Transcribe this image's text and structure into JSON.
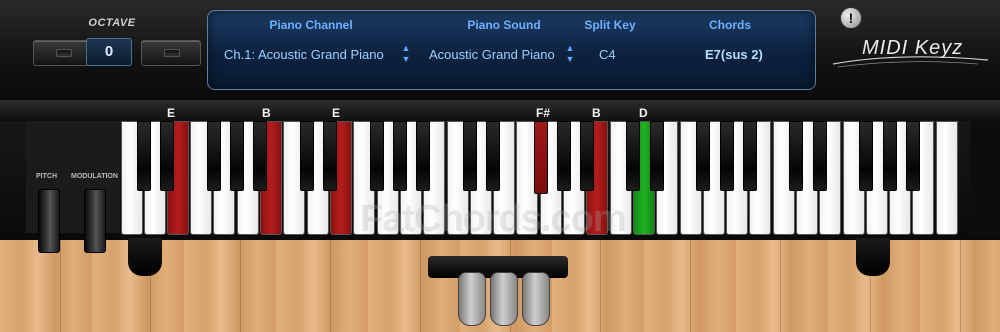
{
  "octave": {
    "label": "OCTAVE",
    "value": "0"
  },
  "lcd": {
    "channel": {
      "header": "Piano Channel",
      "value": "Ch.1: Acoustic Grand Piano"
    },
    "sound": {
      "header": "Piano Sound",
      "value": "Acoustic Grand Piano"
    },
    "split": {
      "header": "Split Key",
      "value": "C4"
    },
    "chords": {
      "header": "Chords",
      "value": "E7(sus 2)"
    }
  },
  "info_button": "!",
  "logo": "MIDI Keyz",
  "wheels": {
    "pitch": "PITCH",
    "modulation": "MODULATION"
  },
  "note_labels": {
    "e1": "E",
    "b1": "B",
    "e2": "E",
    "fs": "F#",
    "b2": "B",
    "d": "D"
  },
  "highlight_colors": {
    "chord": "#b51d1d",
    "bass": "#21b322"
  },
  "watermark": "FatChords.com"
}
